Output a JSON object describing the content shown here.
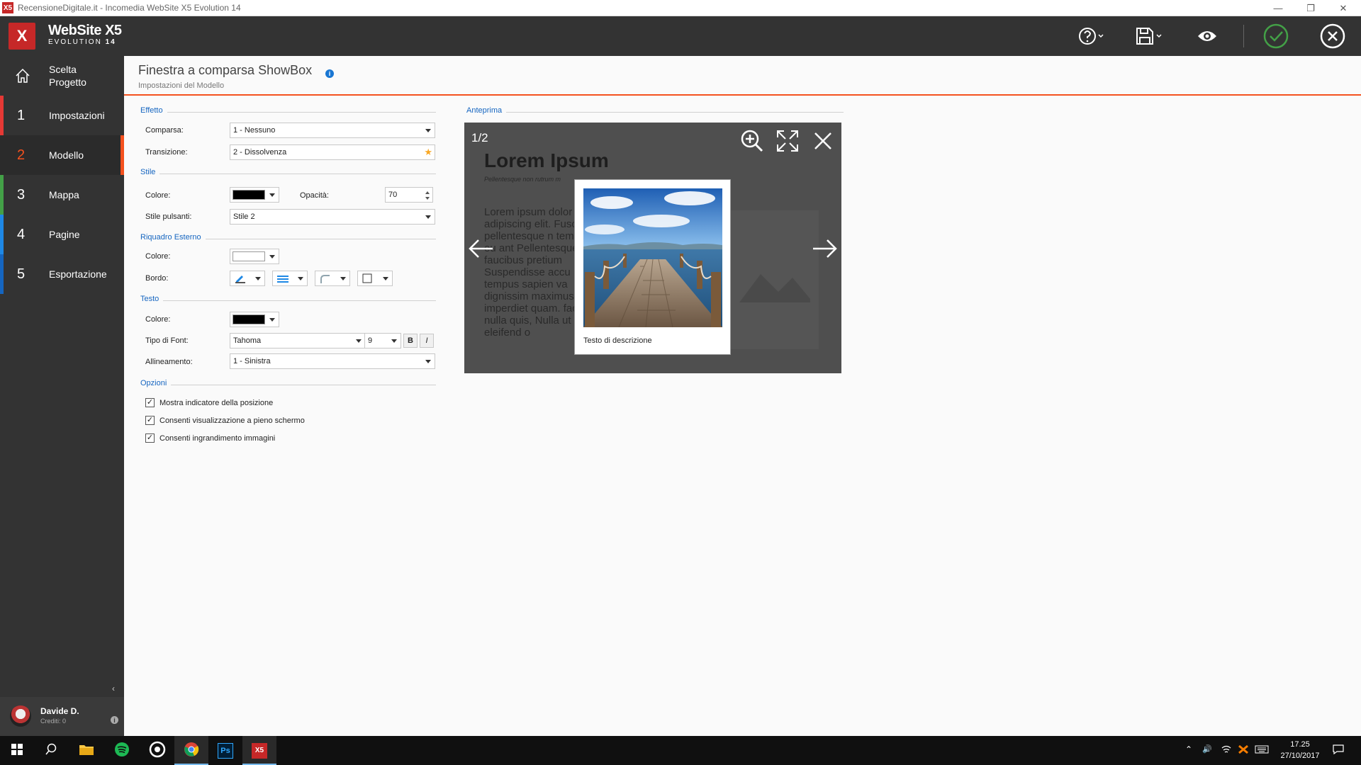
{
  "window": {
    "title": "RecensioneDigitale.it - Incomedia WebSite X5 Evolution 14",
    "controls": {
      "minimize": "—",
      "restore": "❐",
      "close": "✕"
    }
  },
  "header": {
    "logo_line1": "WebSite X5",
    "logo_line2_prefix": "EVOLUTION",
    "logo_line2_num": "14",
    "buttons": [
      "help-icon",
      "save-icon",
      "preview-eye-icon",
      "confirm-check-icon",
      "close-circle-icon"
    ]
  },
  "sidebar": {
    "items": [
      {
        "num": "",
        "label": "Scelta Progetto",
        "color": "#333333"
      },
      {
        "num": "1",
        "label": "Impostazioni",
        "color": "#e53935"
      },
      {
        "num": "2",
        "label": "Modello",
        "color": "#f4511e"
      },
      {
        "num": "3",
        "label": "Mappa",
        "color": "#43a047"
      },
      {
        "num": "4",
        "label": "Pagine",
        "color": "#1e88e5"
      },
      {
        "num": "5",
        "label": "Esportazione",
        "color": "#1565c0"
      }
    ],
    "active_index": 2,
    "collapse": "‹",
    "user": {
      "name": "Davide D.",
      "credits": "Crediti: 0",
      "info": "i"
    }
  },
  "page": {
    "title": "Finestra a comparsa ShowBox",
    "subtitle": "Impostazioni del Modello",
    "info": "i"
  },
  "form": {
    "effetto": {
      "section": "Effetto",
      "comparsa_label": "Comparsa:",
      "comparsa_value": "1 - Nessuno",
      "transizione_label": "Transizione:",
      "transizione_value": "2 - Dissolvenza"
    },
    "stile": {
      "section": "Stile",
      "colore_label": "Colore:",
      "colore_value": "#000000",
      "opacita_label": "Opacità:",
      "opacita_value": "70",
      "pulsanti_label": "Stile pulsanti:",
      "pulsanti_value": "Stile 2"
    },
    "riquadro": {
      "section": "Riquadro Esterno",
      "colore_label": "Colore:",
      "colore_value": "#ffffff",
      "bordo_label": "Bordo:"
    },
    "testo": {
      "section": "Testo",
      "colore_label": "Colore:",
      "colore_value": "#000000",
      "font_label": "Tipo di Font:",
      "font_value": "Tahoma",
      "size_value": "9",
      "bold": "B",
      "italic": "I",
      "allineamento_label": "Allineamento:",
      "allineamento_value": "1 - Sinistra"
    },
    "opzioni": {
      "section": "Opzioni",
      "items": [
        {
          "label": "Mostra indicatore della posizione",
          "checked": true
        },
        {
          "label": "Consenti visualizzazione a pieno schermo",
          "checked": true
        },
        {
          "label": "Consenti ingrandimento immagini",
          "checked": true
        }
      ],
      "check_glyph": "✓"
    }
  },
  "preview": {
    "section": "Anteprima",
    "counter": "1/2",
    "bg_title": "Lorem Ipsum",
    "bg_subtitle": "Pellentesque non rutrum m",
    "bg_paragraph": "Lorem ipsum dolor adipiscing elit. Fusc quis pellentesque n tempus eu ant Pellentesque non faucibus pretium Suspendisse accu tempus sapien va dignissim maximus imperdiet quam. facilisis nulla quis, Nulla ut eleifend o",
    "caption": "Testo di descrizione"
  },
  "taskbar": {
    "apps": [
      "windows-start-icon",
      "search-icon",
      "file-explorer-icon",
      "spotify-icon",
      "media-icon",
      "chrome-icon",
      "photoshop-icon",
      "websitex5-icon"
    ],
    "ps_label": "Ps",
    "x5_label": "X5",
    "tray_up": "⌃",
    "tray_speaker": "🔊",
    "time": "17.25",
    "date": "27/10/2017"
  }
}
